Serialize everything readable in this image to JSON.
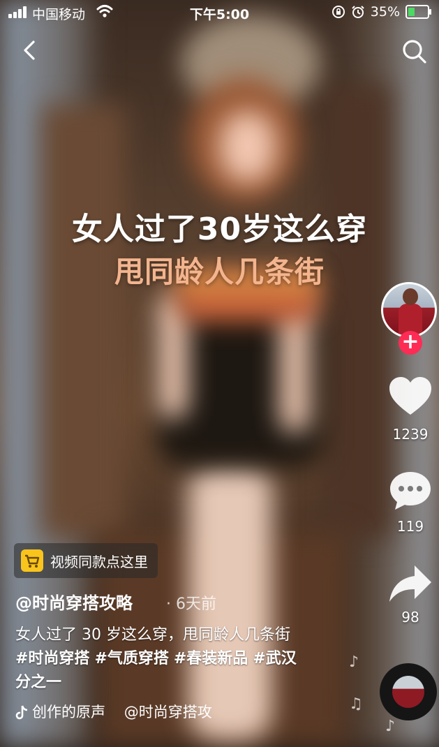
{
  "status_bar": {
    "carrier": "中国移动",
    "time": "下午5:00",
    "battery": "35%",
    "battery_level": 0.35
  },
  "icons": {
    "back": "chevron-left-icon",
    "search": "search-icon",
    "like": "heart-icon",
    "comment": "comment-icon",
    "share": "share-icon",
    "music": "tiktok-note-icon",
    "product": "cart-icon"
  },
  "video": {
    "caption_line1": "女人过了30岁这么穿",
    "caption_line2": "甩同龄人几条街"
  },
  "actions": {
    "follow_symbol": "+",
    "likes": "1239",
    "comments": "119",
    "shares": "98"
  },
  "product": {
    "label": "视频同款点这里"
  },
  "post": {
    "author": "@时尚穿搭攻略",
    "time_ago": "· 6天前",
    "text": "女人过了 30 岁这么穿，甩同龄人几条街",
    "tags": [
      "#时尚穿搭",
      "#气质穿搭",
      "#春装新品",
      "#武汉"
    ],
    "text_tail": "分之一"
  },
  "music": {
    "title": "创作的原声",
    "author": "@时尚穿搭攻"
  },
  "colors": {
    "follow": "#fe2c55",
    "cart": "#f9c51d",
    "caption_accent": "#f3b48e",
    "battery_fill": "#4cd964"
  }
}
